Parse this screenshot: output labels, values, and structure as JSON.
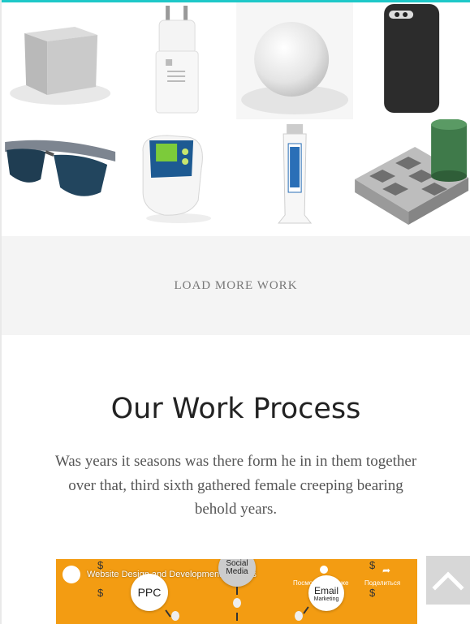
{
  "portfolio": {
    "items": [
      {
        "icon": "cube-icon"
      },
      {
        "icon": "charger-icon"
      },
      {
        "icon": "sphere-icon"
      },
      {
        "icon": "phone-case-icon"
      },
      {
        "icon": "sunglasses-icon"
      },
      {
        "icon": "device-icon"
      },
      {
        "icon": "paint-tube-icon"
      },
      {
        "icon": "checkerboard-icon"
      }
    ],
    "load_more_label": "LOAD MORE WORK"
  },
  "process": {
    "title": "Our Work Process",
    "text": "Was years it seasons was there form he in in them together over that, third sixth gathered female creeping bearing behold years."
  },
  "video": {
    "title": "Website Design and Development Process",
    "watch_later": "Посмотреть позже",
    "share": "Поделиться",
    "nodes": {
      "ppc": "PPC",
      "social_line1": "Social",
      "social_line2": "Media",
      "email": "Email",
      "email_sub": "Marketing"
    },
    "dollar": "$"
  },
  "colors": {
    "accent": "#1ec8c8",
    "video_bg": "#f39c12",
    "section_bg": "#f4f4f4"
  },
  "scroll_top": {
    "icon": "chevron-up-icon"
  }
}
